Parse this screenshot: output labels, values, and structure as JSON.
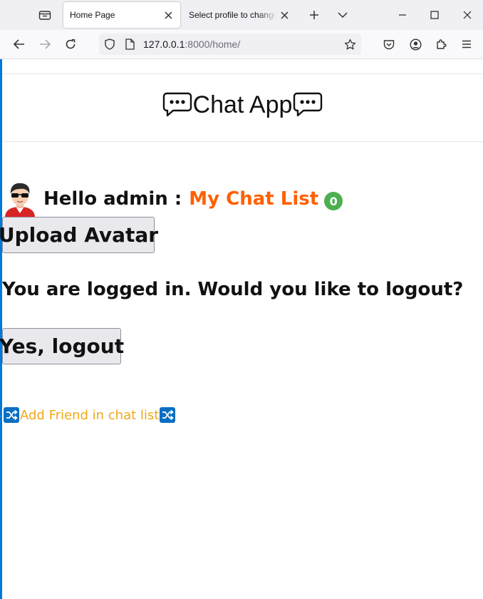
{
  "browser": {
    "tabs": [
      {
        "title": "Home Page",
        "active": true
      },
      {
        "title": "Select profile to change | Django site admin",
        "active": false
      }
    ],
    "url_host": "127.0.0.1",
    "url_path": ":8000/home/"
  },
  "page": {
    "app_title": "Chat App",
    "greeting": "Hello admin :",
    "chat_list_link": "My Chat List",
    "chat_count": "0",
    "upload_avatar_button": "Upload Avatar",
    "logout_question": "You are logged in. Would you like to logout?",
    "logout_button": "Yes, logout",
    "add_friend_link": "Add Friend in chat list"
  },
  "colors": {
    "link_orange": "#ff6000",
    "badge_green": "#4caf50",
    "add_friend_gold": "#f0a818",
    "shuffle_blue": "#0a6fc2"
  },
  "icons": [
    "tab-overview-icon",
    "close-icon",
    "plus-icon",
    "chevron-down-icon",
    "minimize-icon",
    "maximize-icon",
    "back-icon",
    "forward-icon",
    "reload-icon",
    "shield-icon",
    "page-icon",
    "bookmark-star-icon",
    "pocket-icon",
    "account-icon",
    "extensions-icon",
    "menu-icon",
    "speech-balloon-icon",
    "shuffle-icon"
  ]
}
